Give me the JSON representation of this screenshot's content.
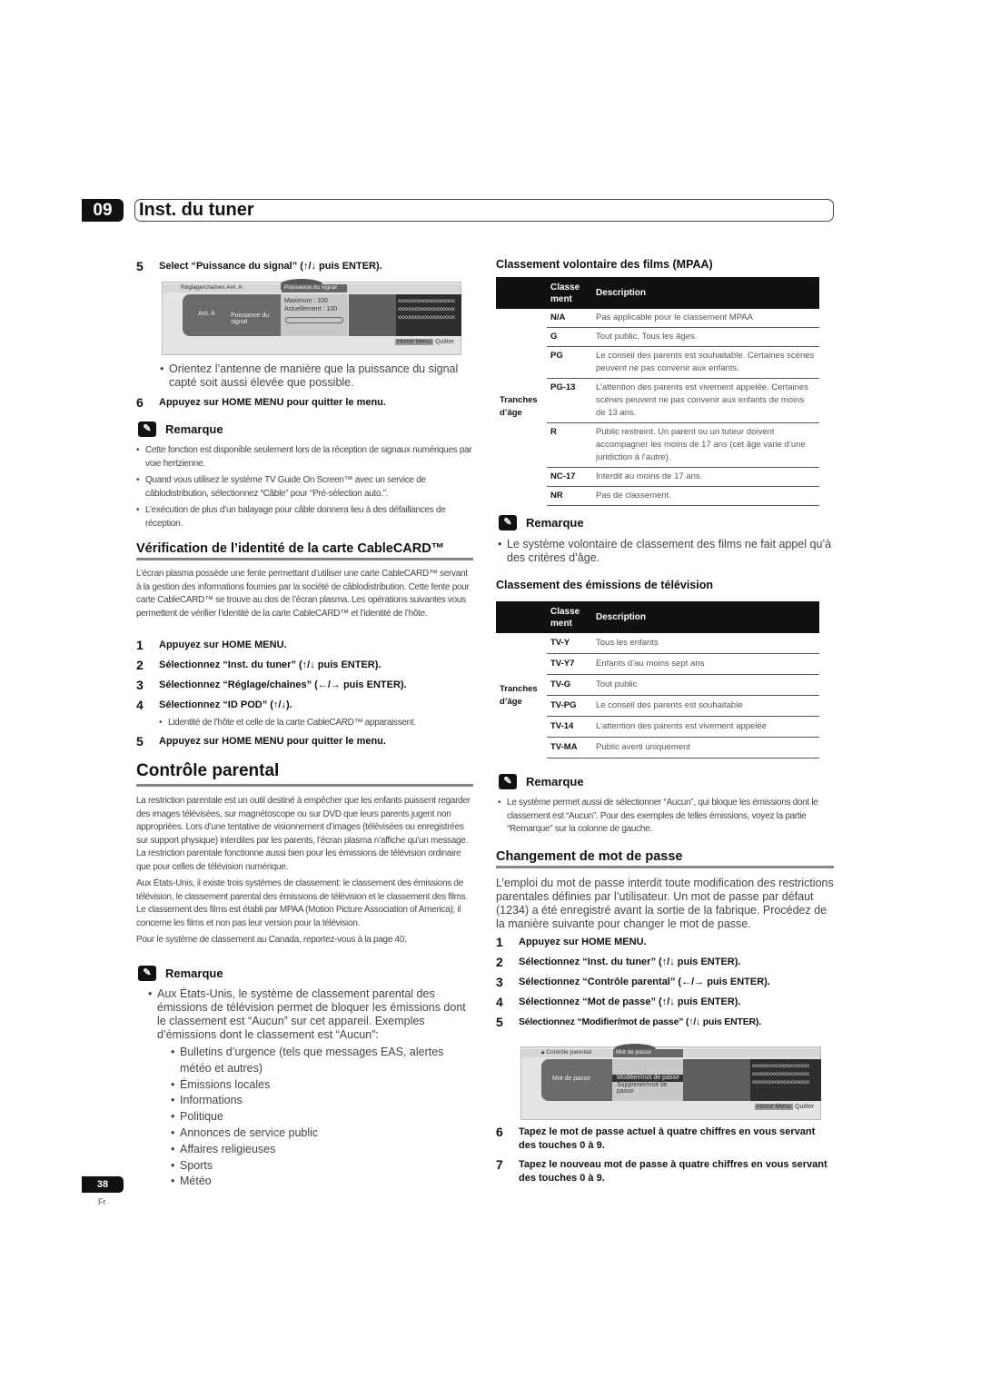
{
  "chapter": {
    "number": "09",
    "title": "Inst. du tuner"
  },
  "left": {
    "step5": {
      "n": "5",
      "text": "Select “Puissance du signal” (↑/↓ puis ENTER)."
    },
    "screen1": {
      "bar_label": "Réglage/chaînes",
      "bar_sub": "Ant. A",
      "tab": "Puissance du signal",
      "left_a": "Ant. A",
      "left_b": "Puissance du signal",
      "max": "Maximum :  100",
      "cur": "Actuellement :  100",
      "x": "xxxxxxxxxxxxxxxxxxxxx",
      "home": "Home Menu",
      "quit": "Quitter"
    },
    "bullet1": "Orientez l’antenne de manière que la puissance du signal capté soit aussi élevée que possible.",
    "step6": {
      "n": "6",
      "text": "Appuyez sur HOME MENU pour quitter le menu."
    },
    "remarque1": {
      "title": "Remarque",
      "items": [
        "Cette fonction est disponible seulement lors de la réception de signaux numériques par voie hertzienne.",
        "Quand vous utilisez le système TV Guide On Screen™ avec un service de câblodistribution, sélectionnez “Câble” pour “Pré-sélection auto.”.",
        "L’exécution de plus d’un balayage pour câble donnera lieu à des défaillances de réception."
      ]
    },
    "cablecard": {
      "title": "Vérification de l’identité de la carte CableCARD™",
      "para": "L’écran plasma possède une fente permettant d’utiliser une carte CableCARD™ servant à la gestion des informations fournies par la société de câblodistribution. Cette fente pour carte CableCARD™ se trouve au dos de l’écran plasma. Les opérations suivantes vous permettent de vérifier l’identité de la carte CableCARD™ et l’identité de l’hôte.",
      "steps": [
        {
          "n": "1",
          "text": "Appuyez sur HOME MENU."
        },
        {
          "n": "2",
          "text": "Sélectionnez “Inst. du tuner” (↑/↓ puis ENTER)."
        },
        {
          "n": "3",
          "text": "Sélectionnez “Réglage/chaînes” (←/→ puis ENTER)."
        },
        {
          "n": "4",
          "text": "Sélectionnez “ID POD” (↑/↓)."
        }
      ],
      "note": "Lidentité de l’hôte et celle de la carte CableCARD™ apparaissent.",
      "step5": {
        "n": "5",
        "text": "Appuyez sur HOME MENU pour quitter le menu."
      }
    },
    "parental": {
      "title": "Contrôle parental",
      "para1": "La restriction parentale est un outil destiné à empêcher que les enfants puissent regarder des images télévisées, sur magnétoscope ou sur DVD que leurs parents jugent non appropriées. Lors d’une tentative de visionnement d’images (télévisées ou enregistrées sur support physique) interdites par les parents, l’écran plasma n’affiche qu’un message. La restriction parentale fonctionne aussi bien pour les émissions de télévision ordinaire que pour celles de télévision numérique.",
      "para2": "Aux États-Unis, il existe trois systèmes de classement: le classement des émissions de télévision, le classement parental des émissions de télévision et le classement des films. Le classement des films est établi par MPAA (Motion Picture Association of America); il concerne les films et non pas leur version pour la télévision.",
      "para3": "Pour le système de classement au Canada, reportez-vous à la page 40."
    },
    "remarque2": {
      "title": "Remarque",
      "text": "Aux États-Unis, le système de classement parental des émissions de télévision permet de bloquer les émissions dont le classement est “Aucun” sur cet appareil. Exemples d’émissions dont le classement est “Aucun”:",
      "items": [
        "Bulletins d’urgence (tels que messages EAS, alertes météo et autres)",
        "Émissions locales",
        "Informations",
        "Politique",
        "Annonces de service public",
        "Affaires religieuses",
        "Sports",
        "Météo"
      ]
    }
  },
  "right": {
    "mpaa": {
      "title": "Classement volontaire des films (MPAA)",
      "headers": [
        "Classe ment",
        "Description"
      ],
      "group": "Tranches d’âge",
      "rows": [
        [
          "N/A",
          "Pas applicable pour le classement MPAA"
        ],
        [
          "G",
          "Tout public. Tous les âges."
        ],
        [
          "PG",
          "Le conseil des parents est souhaitable. Certaines scènes peuvent ne pas convenir aux enfants."
        ],
        [
          "PG-13",
          "L’attention des parents est vivement appelée. Certaines scènes peuvent ne pas convenir aux enfants de moins de 13 ans."
        ],
        [
          "R",
          "Public restreint. Un parent ou un tuteur doivent accompagner les moins de 17 ans (cet âge varie d’une juridiction à l’autre)."
        ],
        [
          "NC-17",
          "Interdit au moins de 17 ans."
        ],
        [
          "NR",
          "Pas de classement."
        ]
      ]
    },
    "remarque3": {
      "title": "Remarque",
      "text": "Le système volontaire de classement des films ne fait appel qu’à des critères d’âge."
    },
    "tv": {
      "title": "Classement des émissions de télévision",
      "headers": [
        "Classe ment",
        "Description"
      ],
      "group": "Tranches d’âge",
      "rows": [
        [
          "TV-Y",
          "Tous les enfants"
        ],
        [
          "TV-Y7",
          "Enfants d’au moins sept ans"
        ],
        [
          "TV-G",
          "Tout public"
        ],
        [
          "TV-PG",
          "Le conseil des parents est souhaitable"
        ],
        [
          "TV-14",
          "L’attention des parents est vivement appelée"
        ],
        [
          "TV-MA",
          "Public averti uniquement"
        ]
      ]
    },
    "remarque4": {
      "title": "Remarque",
      "text": "Le système permet aussi de sélectionner “Aucun”, qui bloque les émissions dont le classement est “Aucun”. Pour des exemples de telles émissions, voyez la partie “Remarque” sur la colonne de gauche."
    },
    "password": {
      "title": "Changement de mot de passe",
      "para": "L’emploi du mot de passe interdit toute modification des restrictions parentales définies par l’utilisateur. Un mot de passe par défaut (1234) a été enregistré avant la sortie de la fabrique. Procédez de la manière suivante pour changer le mot de passe.",
      "steps": [
        {
          "n": "1",
          "text": "Appuyez sur HOME MENU."
        },
        {
          "n": "2",
          "text": "Sélectionnez “Inst. du tuner” (↑/↓ puis ENTER)."
        },
        {
          "n": "3",
          "text": "Sélectionnez “Contrôle parental” (←/→ puis ENTER)."
        },
        {
          "n": "4",
          "text": "Sélectionnez “Mot de passe” (↑/↓ puis ENTER)."
        },
        {
          "n": "5",
          "text": "Sélectionnez “Modifier/mot de passe” (↑/↓ puis ENTER)."
        }
      ],
      "screen": {
        "bar_label": "Contrôle parental",
        "tab": "Mot de passe",
        "left": "Mot de passe",
        "opt1": "Modifier/mot de passe",
        "opt2": "Supprimer/mot de passe",
        "x": "xxxxxxxxxxxxxxxxxxxxx",
        "home": "Home Menu",
        "quit": "Quitter"
      },
      "steps2": [
        {
          "n": "6",
          "text": "Tapez le mot de passe actuel à quatre chiffres en vous servant des touches 0 à 9."
        },
        {
          "n": "7",
          "text": "Tapez le nouveau mot de passe à quatre chiffres en vous servant des touches 0 à 9."
        }
      ]
    }
  },
  "footer": {
    "page": "38",
    "lang": "Fr"
  }
}
